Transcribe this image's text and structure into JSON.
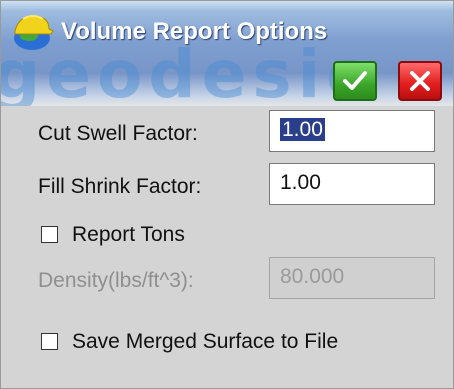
{
  "window": {
    "title": "Volume Report Options",
    "watermark": "geodesic"
  },
  "toolbar": {
    "ok_icon": "checkmark-icon",
    "cancel_icon": "close-icon",
    "ok_color": "#3aa628",
    "cancel_color": "#e21c1c"
  },
  "form": {
    "cut_swell": {
      "label": "Cut Swell Factor:",
      "value": "1.00"
    },
    "fill_shrink": {
      "label": "Fill Shrink Factor:",
      "value": "1.00"
    },
    "report_tons": {
      "label": "Report Tons",
      "checked": false
    },
    "density": {
      "label": "Density(lbs/ft^3):",
      "value": "80.000"
    },
    "save_merged": {
      "label": "Save Merged Surface to File",
      "checked": false
    }
  }
}
